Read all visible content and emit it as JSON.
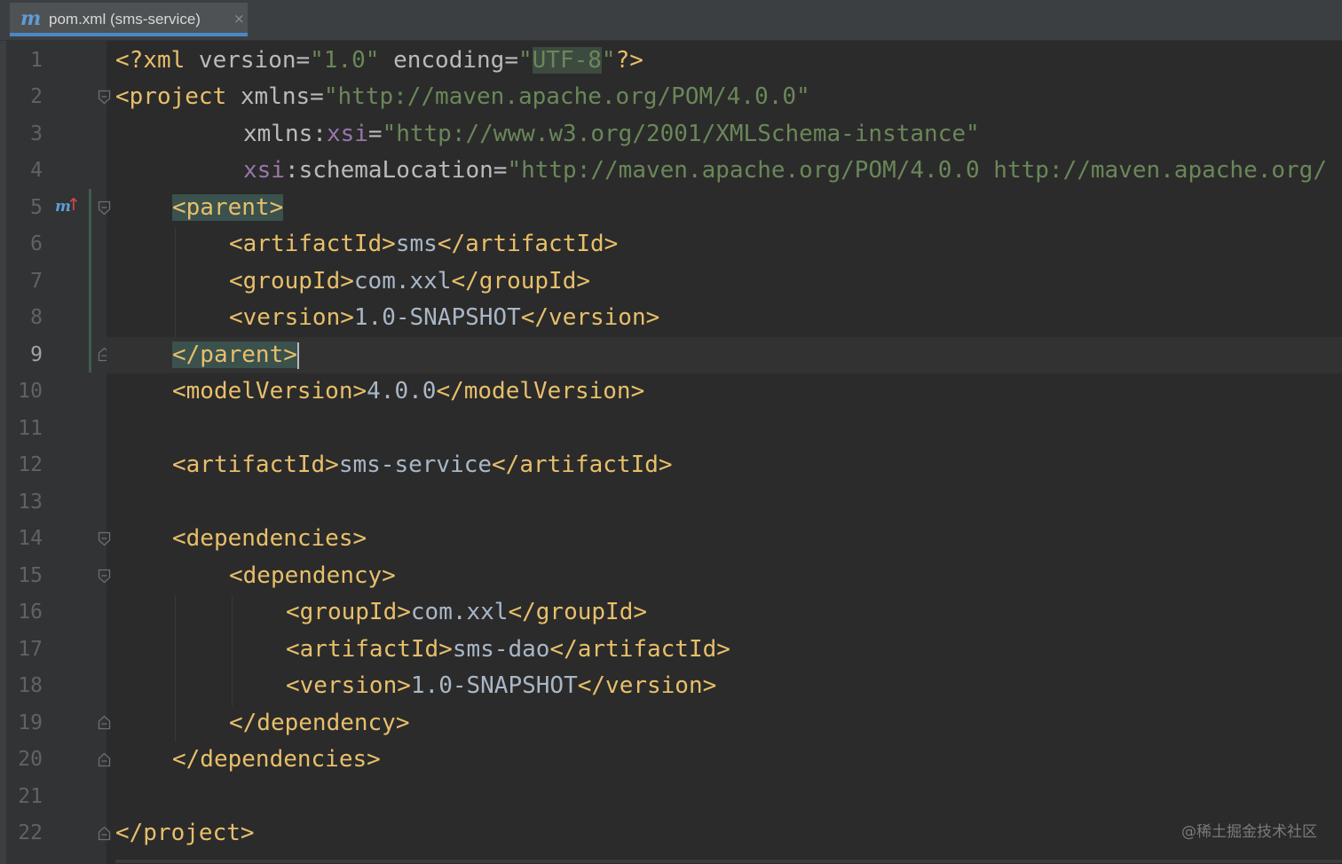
{
  "tab": {
    "icon": "m",
    "label": "pom.xml (sms-service)",
    "close": "×"
  },
  "gutter": {
    "line_numbers": [
      "1",
      "2",
      "3",
      "4",
      "5",
      "6",
      "7",
      "8",
      "9",
      "10",
      "11",
      "12",
      "13",
      "14",
      "15",
      "16",
      "17",
      "18",
      "19",
      "20",
      "21",
      "22"
    ],
    "current_line": "9",
    "override_icon": {
      "letter": "m",
      "arrow": "↑"
    }
  },
  "code": {
    "l1": {
      "p1": "<?xml ",
      "p2": "version",
      "p3": "=",
      "p4": "\"1.0\"",
      "p5": " ",
      "p6": "encoding",
      "p7": "=",
      "p8": "\"",
      "p9": "UTF-8",
      "p10": "\"",
      "p11": "?>"
    },
    "l2": {
      "p1": "<project ",
      "p2": "xmlns",
      "p3": "=",
      "p4": "\"http://maven.apache.org/POM/4.0.0\""
    },
    "l3": {
      "p1": "xmlns",
      "p2": ":",
      "p3": "xsi",
      "p4": "=",
      "p5": "\"http://www.w3.org/2001/XMLSchema-instance\""
    },
    "l4": {
      "p1": "xsi",
      "p2": ":",
      "p3": "schemaLocation",
      "p4": "=",
      "p5": "\"http://maven.apache.org/POM/4.0.0 http://maven.apache.org/"
    },
    "l5": {
      "p1": "<parent>"
    },
    "l6": {
      "p1": "<artifactId>",
      "p2": "sms",
      "p3": "</artifactId>"
    },
    "l7": {
      "p1": "<groupId>",
      "p2": "com.xxl",
      "p3": "</groupId>"
    },
    "l8": {
      "p1": "<version>",
      "p2": "1.0-SNAPSHOT",
      "p3": "</version>"
    },
    "l9": {
      "p1": "</parent>"
    },
    "l10": {
      "p1": "<modelVersion>",
      "p2": "4.0.0",
      "p3": "</modelVersion>"
    },
    "l12": {
      "p1": "<artifactId>",
      "p2": "sms-service",
      "p3": "</artifactId>"
    },
    "l14": {
      "p1": "<dependencies>"
    },
    "l15": {
      "p1": "<dependency>"
    },
    "l16": {
      "p1": "<groupId>",
      "p2": "com.xxl",
      "p3": "</groupId>"
    },
    "l17": {
      "p1": "<artifactId>",
      "p2": "sms-dao",
      "p3": "</artifactId>"
    },
    "l18": {
      "p1": "<version>",
      "p2": "1.0-SNAPSHOT",
      "p3": "</version>"
    },
    "l19": {
      "p1": "</dependency>"
    },
    "l20": {
      "p1": "</dependencies>"
    },
    "l22": {
      "p1": "</project>"
    }
  },
  "watermark": "@稀土掘金技术社区",
  "colors": {
    "background": "#2b2b2b",
    "gutter": "#313335",
    "tag": "#e8bf6a",
    "string": "#6a8759",
    "namespace": "#9876aa",
    "attribute": "#bababa",
    "text": "#a9b7c6",
    "tab_underline": "#4a88c7"
  },
  "icons": [
    "maven-m-icon",
    "close-icon",
    "override-up-arrow-icon",
    "fold-open-icon",
    "fold-close-icon"
  ]
}
